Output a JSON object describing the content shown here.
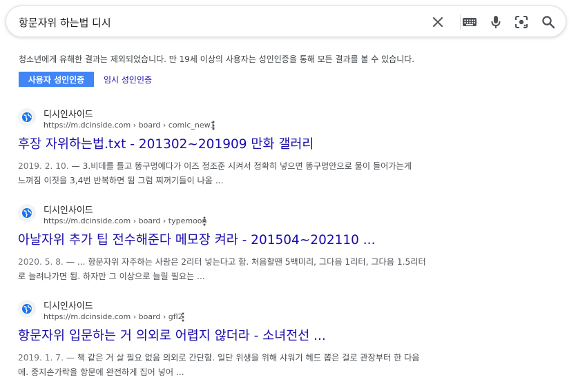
{
  "search": {
    "query": "항문자위 하는법 디시",
    "clear_icon": "close-icon",
    "keyboard_icon": "keyboard-icon",
    "voice_icon": "microphone-icon",
    "lens_icon": "camera-lens-icon",
    "search_icon": "search-icon"
  },
  "safesearch": {
    "notice": "청소년에게 유해한 결과는 제외되었습니다. 만 19세 이상의 사용자는 성인인증을 통해 모든 결과를 볼 수 있습니다.",
    "verify_button": "사용자 성인인증",
    "temp_link": "임시 성인인증",
    "button_color": "#4285f4"
  },
  "results": [
    {
      "site": "디시인사이드",
      "url": "https://m.dcinside.com › board › comic_new1",
      "title": "후장 자위하는법.txt - 201302~201909 만화 갤러리",
      "date": "2019. 2. 10.",
      "snippet_line1": " — 3.비데를 틀고 똥구멍에다가 이즈 정조준 시켜서 정확히 넣으면 똥구멍안으로 물이 들어가는게",
      "snippet_line2": "느껴짐 이짓을 3,4번 반복하면 됨 그럼 찌꺼기들이 나옴 ..."
    },
    {
      "site": "디시인사이드",
      "url": "https://m.dcinside.com › board › typemoon",
      "title": "아날자위 추가 팁 전수해준다 메모장 켜라 - 201504~202110 ...",
      "date": "2020. 5. 8.",
      "snippet_line1": " — ... 항문자위 자주하는 사람은 2리터 넣는다고 함. 처음할땐 5백미리, 그다음 1리터, 그다음 1.5리터",
      "snippet_line2": "로 늘려나가면 됨. 하자만 그 이상으로 늘릴 필요는 ..."
    },
    {
      "site": "디시인사이드",
      "url": "https://m.dcinside.com › board › gfl2",
      "title": "항문자위 입문하는 거 의외로 어렵지 않더라 - 소녀전선 ...",
      "date": "2019. 1. 7.",
      "snippet_line1": " — 책 같은 거 살 필요 없음 의외로 간단함. 일단 위생을 위해 샤워기 헤드 뽑은 걸로 관장부터 한 다음",
      "snippet_line2": "에. 중지손가락을 항문에 완전하게 집어 넣어 ..."
    }
  ],
  "colors": {
    "link": "#1a0dab",
    "text": "#202124",
    "snippet": "#4d5156"
  }
}
